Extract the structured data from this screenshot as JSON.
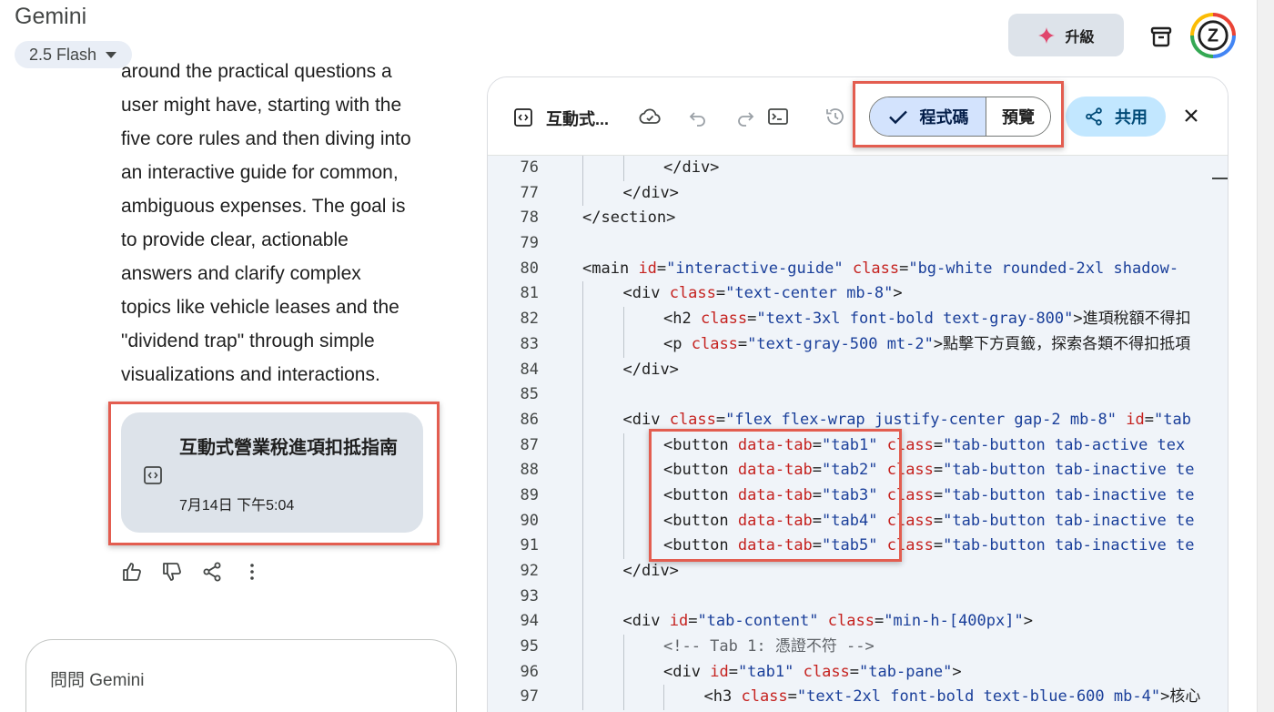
{
  "header": {
    "app_title": "Gemini",
    "model_label": "2.5 Flash",
    "upgrade_label": "升級",
    "upgrade_icon": "sparkle-icon",
    "archive_icon": "archive-icon",
    "avatar_letter": "Z"
  },
  "chat": {
    "lines": [
      "around the practical questions a",
      "user might have, starting with the",
      "five core rules and then diving into",
      "an interactive guide for common,",
      "ambiguous expenses. The goal is",
      "to provide clear, actionable",
      "answers and clarify complex",
      "topics like vehicle leases and the",
      "\"dividend trap\" through simple",
      "visualizations and interactions."
    ],
    "artifact": {
      "title": "互動式營業稅進項扣抵指南",
      "date": "7月14日 下午5:04"
    },
    "ask_placeholder": "問問 Gemini"
  },
  "panel": {
    "title": "互動式...",
    "code_tab": "程式碼",
    "preview_tab": "預覽",
    "share_label": "共用",
    "code_lines": [
      {
        "n": "76",
        "indent": 3,
        "html": "<span class=\"tag\">&lt;/div&gt;</span>"
      },
      {
        "n": "77",
        "indent": 2,
        "html": "<span class=\"tag\">&lt;/div&gt;</span>"
      },
      {
        "n": "78",
        "indent": 1,
        "html": "<span class=\"tag\">&lt;/section&gt;</span>"
      },
      {
        "n": "79",
        "indent": 0,
        "html": ""
      },
      {
        "n": "80",
        "indent": 1,
        "html": "<span class=\"tag\">&lt;main</span> <span class=\"attr\">id</span>=<span class=\"str\">\"interactive-guide\"</span> <span class=\"attr\">class</span>=<span class=\"str\">\"bg-white rounded-2xl shadow-</span>"
      },
      {
        "n": "81",
        "indent": 2,
        "html": "<span class=\"tag\">&lt;div</span> <span class=\"attr\">class</span>=<span class=\"str\">\"text-center mb-8\"</span><span class=\"tag\">&gt;</span>"
      },
      {
        "n": "82",
        "indent": 3,
        "html": "<span class=\"tag\">&lt;h2</span> <span class=\"attr\">class</span>=<span class=\"str\">\"text-3xl font-bold text-gray-800\"</span><span class=\"tag\">&gt;</span>進項稅額不得扣"
      },
      {
        "n": "83",
        "indent": 3,
        "html": "<span class=\"tag\">&lt;p</span> <span class=\"attr\">class</span>=<span class=\"str\">\"text-gray-500 mt-2\"</span><span class=\"tag\">&gt;</span>點擊下方頁籤，探索各類不得扣抵項"
      },
      {
        "n": "84",
        "indent": 2,
        "html": "<span class=\"tag\">&lt;/div&gt;</span>"
      },
      {
        "n": "85",
        "indent": 0,
        "html": ""
      },
      {
        "n": "86",
        "indent": 2,
        "html": "<span class=\"tag\">&lt;div</span> <span class=\"attr\">class</span>=<span class=\"str\">\"flex flex-wrap justify-center gap-2 mb-8\"</span> <span class=\"attr\">id</span>=<span class=\"str\">\"tab</span>"
      },
      {
        "n": "87",
        "indent": 3,
        "html": "<span class=\"tag\">&lt;button</span> <span class=\"attr\">data-tab</span>=<span class=\"str\">\"tab1\"</span> <span class=\"attr\">class</span>=<span class=\"str\">\"tab-button tab-active tex</span>"
      },
      {
        "n": "88",
        "indent": 3,
        "html": "<span class=\"tag\">&lt;button</span> <span class=\"attr\">data-tab</span>=<span class=\"str\">\"tab2\"</span> <span class=\"attr\">class</span>=<span class=\"str\">\"tab-button tab-inactive te</span>"
      },
      {
        "n": "89",
        "indent": 3,
        "html": "<span class=\"tag\">&lt;button</span> <span class=\"attr\">data-tab</span>=<span class=\"str\">\"tab3\"</span> <span class=\"attr\">class</span>=<span class=\"str\">\"tab-button tab-inactive te</span>"
      },
      {
        "n": "90",
        "indent": 3,
        "html": "<span class=\"tag\">&lt;button</span> <span class=\"attr\">data-tab</span>=<span class=\"str\">\"tab4\"</span> <span class=\"attr\">class</span>=<span class=\"str\">\"tab-button tab-inactive te</span>"
      },
      {
        "n": "91",
        "indent": 3,
        "html": "<span class=\"tag\">&lt;button</span> <span class=\"attr\">data-tab</span>=<span class=\"str\">\"tab5\"</span> <span class=\"attr\">class</span>=<span class=\"str\">\"tab-button tab-inactive te</span>"
      },
      {
        "n": "92",
        "indent": 2,
        "html": "<span class=\"tag\">&lt;/div&gt;</span>"
      },
      {
        "n": "93",
        "indent": 0,
        "html": ""
      },
      {
        "n": "94",
        "indent": 2,
        "html": "<span class=\"tag\">&lt;div</span> <span class=\"attr\">id</span>=<span class=\"str\">\"tab-content\"</span> <span class=\"attr\">class</span>=<span class=\"str\">\"min-h-[400px]\"</span><span class=\"tag\">&gt;</span>"
      },
      {
        "n": "95",
        "indent": 3,
        "html": "<span class=\"cmt\">&lt;!-- Tab 1: 憑證不符 --&gt;</span>"
      },
      {
        "n": "96",
        "indent": 3,
        "html": "<span class=\"tag\">&lt;div</span> <span class=\"attr\">id</span>=<span class=\"str\">\"tab1\"</span> <span class=\"attr\">class</span>=<span class=\"str\">\"tab-pane\"</span><span class=\"tag\">&gt;</span>"
      },
      {
        "n": "97",
        "indent": 4,
        "html": "<span class=\"tag\">&lt;h3</span> <span class=\"attr\">class</span>=<span class=\"str\">\"text-2xl font-bold text-blue-600 mb-4\"</span><span class=\"tag\">&gt;</span>核心"
      }
    ]
  },
  "colors": {
    "highlight_box": "#e35d50",
    "code_bg": "#f0f4f9",
    "share_bg": "#c2e7ff",
    "segment_selected_bg": "#d3e3fd",
    "attr_color": "#c5221f",
    "string_color": "#1a3f9a"
  }
}
